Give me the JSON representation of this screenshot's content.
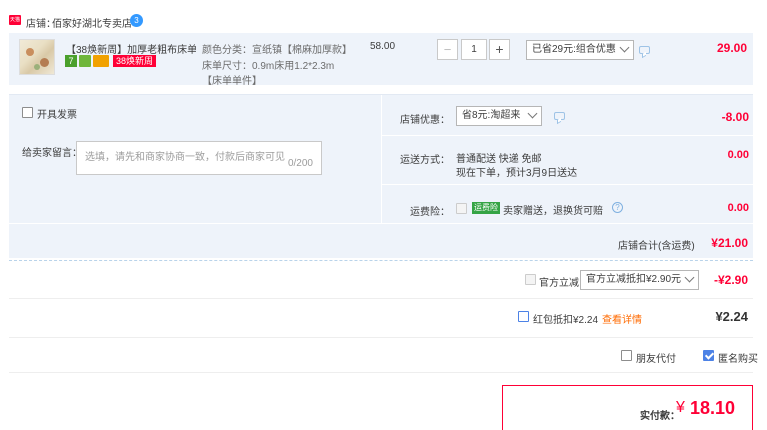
{
  "shop": {
    "badge": "天猫",
    "label": "店铺：",
    "name": "佰家好湖北专卖店",
    "chat_badge": "3"
  },
  "item": {
    "title": "【38焕新周】加厚老粗布床单...",
    "badge_seven": "7",
    "promo_badge": "38焕新周",
    "attr_color": "颜色分类：宣纸镇【棉麻加厚款】",
    "attr_size": "床单尺寸：0.9m床用1.2*2.3m",
    "attr_note": "【床单单件】",
    "price": "58.00",
    "quantity": "1",
    "minus": "−",
    "plus": "+",
    "discount_select": "已省29元:组合优惠",
    "subtotal": "29.00"
  },
  "invoice": {
    "label": "开具发票"
  },
  "note": {
    "label": "给卖家留言：",
    "placeholder": "选填，请先和商家协商一致，付款后商家可见",
    "counter": "0/200"
  },
  "shop_coupon": {
    "label": "店铺优惠：",
    "select": "省8元:淘超来",
    "amount": "-8.00"
  },
  "shipping": {
    "label": "运送方式：",
    "line1": "普通配送 快递 免邮",
    "line2": "现在下单，预计3月9日送达",
    "amount": "0.00"
  },
  "insurance": {
    "label": "运费险：",
    "tag": "运费险",
    "text": "卖家赠送，退换货可赔",
    "amount": "0.00"
  },
  "shop_total": {
    "label": "店铺合计(含运费)",
    "amount": "¥21.00"
  },
  "official": {
    "label": "官方立减",
    "select": "官方立减抵扣¥2.90元",
    "amount": "-¥2.90"
  },
  "redpacket": {
    "label": "红包抵扣¥2.24",
    "link": "查看详情",
    "amount": "¥2.24"
  },
  "friend_pay": {
    "label": "朋友代付"
  },
  "anonymous": {
    "label": "匿名购买"
  },
  "payment": {
    "label": "实付款：",
    "currency": "¥",
    "amount": "18.10"
  },
  "colors": {
    "accent": "#ff0036",
    "panel": "#eef3fa",
    "check": "#4c82e6"
  }
}
